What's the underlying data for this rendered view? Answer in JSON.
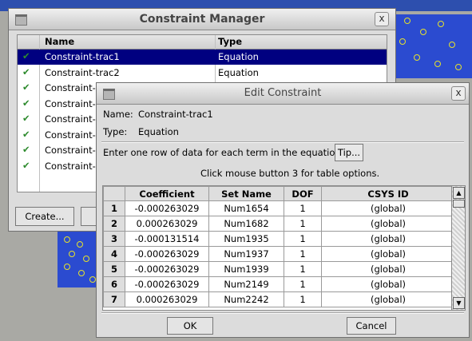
{
  "colors": {
    "selection": "#000080",
    "check": "#2e8b2e",
    "viewport_mesh": "#2b4bd0"
  },
  "manager": {
    "title": "Constraint Manager",
    "close_label": "x",
    "columns": {
      "name": "Name",
      "type": "Type"
    },
    "rows": [
      {
        "check": "✔",
        "name": "Constraint-trac1",
        "type": "Equation",
        "selected": true
      },
      {
        "check": "✔",
        "name": "Constraint-trac2",
        "type": "Equation"
      },
      {
        "check": "✔",
        "name": "Constraint-tra"
      },
      {
        "check": "✔",
        "name": "Constraint-tra"
      },
      {
        "check": "✔",
        "name": "Constraint-tra"
      },
      {
        "check": "✔",
        "name": "Constraint-tra"
      },
      {
        "check": "✔",
        "name": "Constraint-tra"
      },
      {
        "check": "✔",
        "name": "Constraint-tra"
      }
    ],
    "create_label": "Create..."
  },
  "edit": {
    "title": "Edit Constraint",
    "close_label": "x",
    "name_label": "Name:",
    "name_value": "Constraint-trac1",
    "type_label": "Type:",
    "type_value": "Equation",
    "instruction": "Enter one row of data for each term in the equation",
    "tip_label": "Tip...",
    "hint": "Click mouse button 3 for table options.",
    "columns": [
      "Coefficient",
      "Set Name",
      "DOF",
      "CSYS ID"
    ],
    "rows": [
      {
        "n": "1",
        "coef": "-0.000263029",
        "set": "Num1654",
        "dof": "1",
        "csys": "(global)"
      },
      {
        "n": "2",
        "coef": "0.000263029",
        "set": "Num1682",
        "dof": "1",
        "csys": "(global)"
      },
      {
        "n": "3",
        "coef": "-0.000131514",
        "set": "Num1935",
        "dof": "1",
        "csys": "(global)"
      },
      {
        "n": "4",
        "coef": "-0.000263029",
        "set": "Num1937",
        "dof": "1",
        "csys": "(global)"
      },
      {
        "n": "5",
        "coef": "-0.000263029",
        "set": "Num1939",
        "dof": "1",
        "csys": "(global)"
      },
      {
        "n": "6",
        "coef": "-0.000263029",
        "set": "Num2149",
        "dof": "1",
        "csys": "(global)"
      },
      {
        "n": "7",
        "coef": "0.000263029",
        "set": "Num2242",
        "dof": "1",
        "csys": "(global)"
      }
    ],
    "ok_label": "OK",
    "cancel_label": "Cancel"
  }
}
